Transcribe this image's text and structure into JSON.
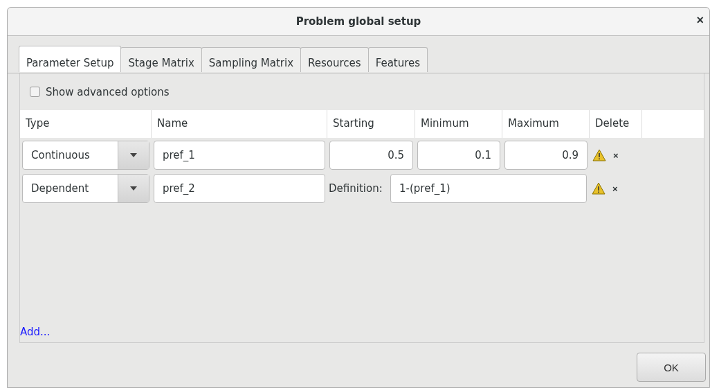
{
  "window": {
    "title": "Problem global setup",
    "close": "×"
  },
  "tabs": [
    {
      "label": "Parameter Setup",
      "selected": true
    },
    {
      "label": "Stage Matrix",
      "selected": false
    },
    {
      "label": "Sampling Matrix",
      "selected": false
    },
    {
      "label": "Resources",
      "selected": false
    },
    {
      "label": "Features",
      "selected": false
    }
  ],
  "advanced_option": {
    "label": "Show advanced options",
    "checked": false
  },
  "table": {
    "columns": [
      "Type",
      "Name",
      "Starting",
      "Minimum",
      "Maximum",
      "Delete"
    ],
    "rows": [
      {
        "kind": "continuous",
        "type": "Continuous",
        "name": "pref_1",
        "starting": "0.5",
        "minimum": "0.1",
        "maximum": "0.9",
        "delete": "×"
      },
      {
        "kind": "dependent",
        "type": "Dependent",
        "name": "pref_2",
        "definition_label": "Definition:",
        "definition": "1-(pref_1)",
        "delete": "×"
      }
    ]
  },
  "add_link": "Add...",
  "buttons": [
    "OK"
  ]
}
